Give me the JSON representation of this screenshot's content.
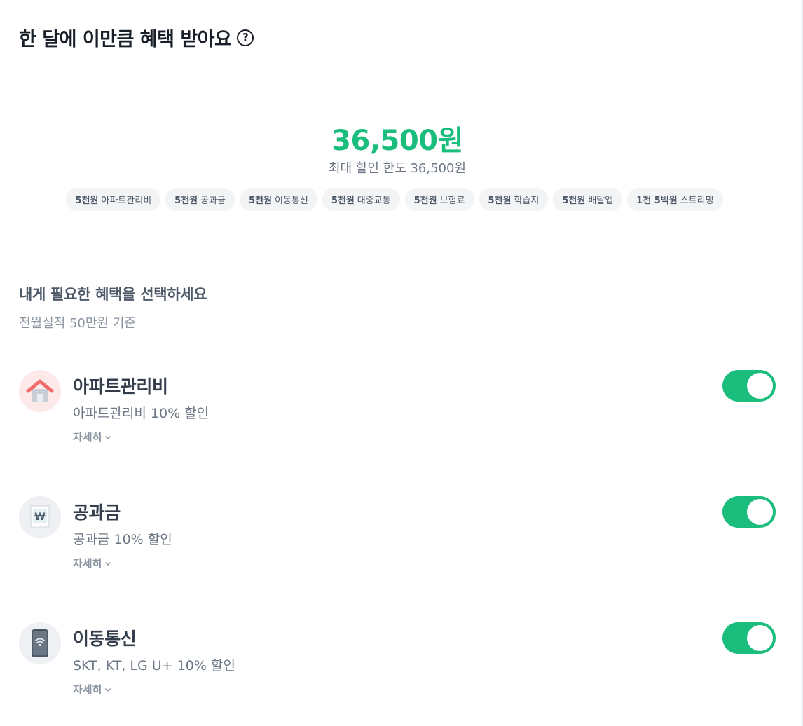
{
  "header": {
    "title": "한 달에 이만큼 혜택 받아요",
    "help_glyph": "?"
  },
  "summary": {
    "amount": "36,500원",
    "limit_text": "최대 할인 한도 36,500원",
    "chips": [
      {
        "amount": "5천원",
        "label": "아파트관리비"
      },
      {
        "amount": "5천원",
        "label": "공과금"
      },
      {
        "amount": "5천원",
        "label": "이동통신"
      },
      {
        "amount": "5천원",
        "label": "대중교통"
      },
      {
        "amount": "5천원",
        "label": "보험료"
      },
      {
        "amount": "5천원",
        "label": "학습지"
      },
      {
        "amount": "5천원",
        "label": "배달앱"
      },
      {
        "amount": "1천 5백원",
        "label": "스트리밍"
      }
    ]
  },
  "select_section": {
    "title": "내게 필요한 혜택을 선택하세요",
    "subtitle": "전월실적 50만원 기준"
  },
  "benefits": [
    {
      "name": "아파트관리비",
      "desc": "아파트관리비 10% 할인",
      "more": "자세히",
      "icon": "house-icon",
      "enabled": true
    },
    {
      "name": "공과금",
      "desc": "공과금 10% 할인",
      "more": "자세히",
      "icon": "won-receipt-icon",
      "enabled": true
    },
    {
      "name": "이동통신",
      "desc": "SKT, KT, LG U+ 10% 할인",
      "more": "자세히",
      "icon": "phone-wifi-icon",
      "enabled": true
    }
  ],
  "colors": {
    "accent": "#1bbd7d",
    "chip_bg": "#f2f4f6",
    "text_primary": "#191f28",
    "text_secondary": "#6b7684"
  }
}
